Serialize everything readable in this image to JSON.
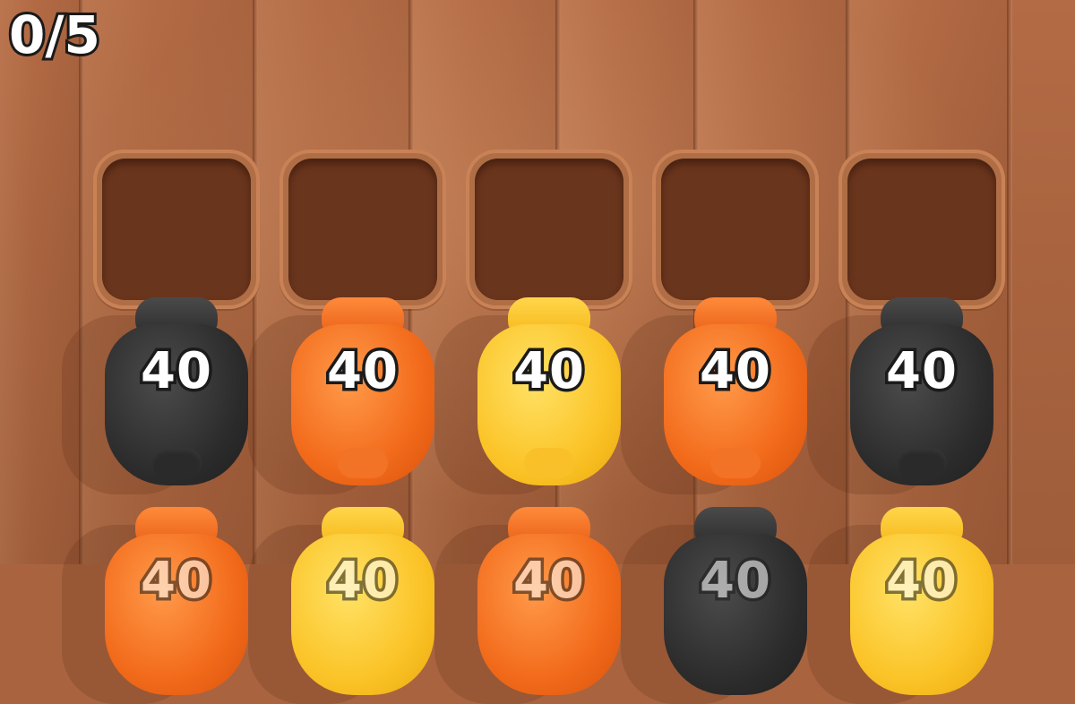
{
  "hud": {
    "progress_text": "0/5",
    "collected": 0,
    "target": 5
  },
  "slots": [
    {
      "state": "empty"
    },
    {
      "state": "empty"
    },
    {
      "state": "empty"
    },
    {
      "state": "empty"
    },
    {
      "state": "empty"
    }
  ],
  "jars_row1": [
    {
      "color": "black",
      "value": "40"
    },
    {
      "color": "orange",
      "value": "40"
    },
    {
      "color": "yellow",
      "value": "40"
    },
    {
      "color": "orange",
      "value": "40"
    },
    {
      "color": "black",
      "value": "40"
    }
  ],
  "jars_row2": [
    {
      "color": "orange",
      "value": "40"
    },
    {
      "color": "yellow",
      "value": "40"
    },
    {
      "color": "orange",
      "value": "40"
    },
    {
      "color": "black",
      "value": "40"
    },
    {
      "color": "yellow",
      "value": "40"
    }
  ],
  "colors": {
    "black": "#2b2b2b",
    "orange": "#f26b1b",
    "yellow": "#fbc428",
    "slot": "#6a351d"
  }
}
